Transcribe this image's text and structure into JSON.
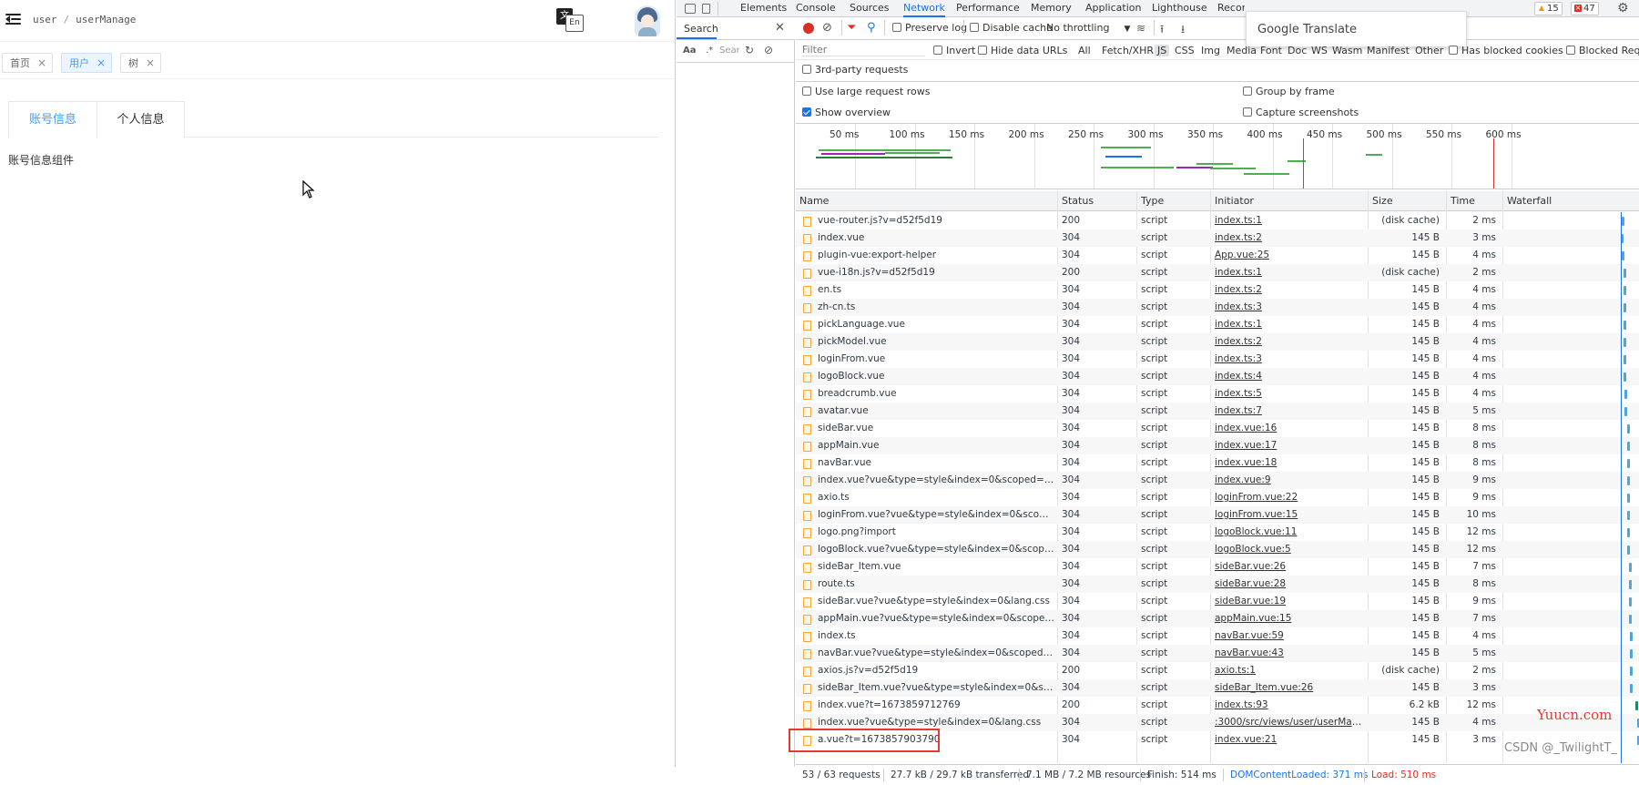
{
  "app": {
    "breadcrumb": [
      "user",
      "userManage"
    ],
    "language_icon": {
      "zh": "文",
      "en": "En"
    },
    "tags": [
      {
        "label": "首页",
        "active": false
      },
      {
        "label": "用户",
        "active": true
      },
      {
        "label": "树",
        "active": false
      }
    ],
    "tabs": [
      {
        "label": "账号信息",
        "active": true
      },
      {
        "label": "个人信息",
        "active": false
      }
    ],
    "panel_text": "账号信息组件"
  },
  "devtools": {
    "tabs": [
      "Elements",
      "Console",
      "Sources",
      "Network",
      "Performance",
      "Memory",
      "Application",
      "Lighthouse",
      "Recor"
    ],
    "active_tab": "Network",
    "translate_popup": "Google Translate",
    "warnings": "15",
    "errors": "47",
    "search": {
      "title": "Search",
      "case_label": "Aa",
      "regex_label": ".*",
      "placeholder": "Sear"
    },
    "toolbar": {
      "preserve_log": "Preserve log",
      "disable_cache": "Disable cache",
      "throttling": "No throttling"
    },
    "filter": {
      "placeholder": "Filter",
      "invert": "Invert",
      "hide_data_urls": "Hide data URLs",
      "types": [
        "All",
        "Fetch/XHR",
        "JS",
        "CSS",
        "Img",
        "Media",
        "Font",
        "Doc",
        "WS",
        "Wasm",
        "Manifest",
        "Other"
      ],
      "active_type": "JS",
      "blocked_cookies": "Has blocked cookies",
      "blocked_requests": "Blocked Reque"
    },
    "third_party": "3rd-party requests",
    "settings": {
      "large_rows": "Use large request rows",
      "show_overview": "Show overview",
      "group_by_frame": "Group by frame",
      "capture_screenshots": "Capture screenshots"
    },
    "overview_ticks": [
      "50 ms",
      "100 ms",
      "150 ms",
      "200 ms",
      "250 ms",
      "300 ms",
      "350 ms",
      "400 ms",
      "450 ms",
      "500 ms",
      "550 ms",
      "600 ms"
    ],
    "columns": [
      "Name",
      "Status",
      "Type",
      "Initiator",
      "Size",
      "Time",
      "Waterfall"
    ],
    "requests": [
      {
        "name": "vue-router.js?v=d52f5d19",
        "status": "200",
        "type": "script",
        "initiator": "index.ts:1",
        "size": "(disk cache)",
        "time": "2 ms",
        "wf": 0.88
      },
      {
        "name": "index.vue",
        "status": "304",
        "type": "script",
        "initiator": "index.ts:2",
        "size": "145 B",
        "time": "3 ms",
        "wf": 0.87
      },
      {
        "name": "plugin-vue:export-helper",
        "status": "304",
        "type": "script",
        "initiator": "App.vue:25",
        "size": "145 B",
        "time": "4 ms",
        "wf": 0.88
      },
      {
        "name": "vue-i18n.js?v=d52f5d19",
        "status": "200",
        "type": "script",
        "initiator": "index.ts:1",
        "size": "(disk cache)",
        "time": "2 ms",
        "wf": 0.89
      },
      {
        "name": "en.ts",
        "status": "304",
        "type": "script",
        "initiator": "index.ts:2",
        "size": "145 B",
        "time": "4 ms",
        "wf": 0.89
      },
      {
        "name": "zh-cn.ts",
        "status": "304",
        "type": "script",
        "initiator": "index.ts:3",
        "size": "145 B",
        "time": "4 ms",
        "wf": 0.89
      },
      {
        "name": "pickLanguage.vue",
        "status": "304",
        "type": "script",
        "initiator": "index.ts:1",
        "size": "145 B",
        "time": "4 ms",
        "wf": 0.89
      },
      {
        "name": "pickModel.vue",
        "status": "304",
        "type": "script",
        "initiator": "index.ts:2",
        "size": "145 B",
        "time": "4 ms",
        "wf": 0.89
      },
      {
        "name": "loginFrom.vue",
        "status": "304",
        "type": "script",
        "initiator": "index.ts:3",
        "size": "145 B",
        "time": "4 ms",
        "wf": 0.89
      },
      {
        "name": "logoBlock.vue",
        "status": "304",
        "type": "script",
        "initiator": "index.ts:4",
        "size": "145 B",
        "time": "4 ms",
        "wf": 0.89
      },
      {
        "name": "breadcrumb.vue",
        "status": "304",
        "type": "script",
        "initiator": "index.ts:5",
        "size": "145 B",
        "time": "4 ms",
        "wf": 0.9
      },
      {
        "name": "avatar.vue",
        "status": "304",
        "type": "script",
        "initiator": "index.ts:7",
        "size": "145 B",
        "time": "5 ms",
        "wf": 0.9
      },
      {
        "name": "sideBar.vue",
        "status": "304",
        "type": "script",
        "initiator": "index.vue:16",
        "size": "145 B",
        "time": "8 ms",
        "wf": 0.92
      },
      {
        "name": "appMain.vue",
        "status": "304",
        "type": "script",
        "initiator": "index.vue:17",
        "size": "145 B",
        "time": "8 ms",
        "wf": 0.92
      },
      {
        "name": "navBar.vue",
        "status": "304",
        "type": "script",
        "initiator": "index.vue:18",
        "size": "145 B",
        "time": "8 ms",
        "wf": 0.92
      },
      {
        "name": "index.vue?vue&type=style&index=0&scoped=true...",
        "status": "304",
        "type": "script",
        "initiator": "index.vue:9",
        "size": "145 B",
        "time": "9 ms",
        "wf": 0.92
      },
      {
        "name": "axio.ts",
        "status": "304",
        "type": "script",
        "initiator": "loginFrom.vue:22",
        "size": "145 B",
        "time": "9 ms",
        "wf": 0.92
      },
      {
        "name": "loginFrom.vue?vue&type=style&index=0&scoped=t...",
        "status": "304",
        "type": "script",
        "initiator": "loginFrom.vue:15",
        "size": "145 B",
        "time": "10 ms",
        "wf": 0.92
      },
      {
        "name": "logo.png?import",
        "status": "304",
        "type": "script",
        "initiator": "logoBlock.vue:11",
        "size": "145 B",
        "time": "12 ms",
        "wf": 0.92
      },
      {
        "name": "logoBlock.vue?vue&type=style&index=0&scoped=t...",
        "status": "304",
        "type": "script",
        "initiator": "logoBlock.vue:5",
        "size": "145 B",
        "time": "12 ms",
        "wf": 0.92
      },
      {
        "name": "sideBar_Item.vue",
        "status": "304",
        "type": "script",
        "initiator": "sideBar.vue:26",
        "size": "145 B",
        "time": "7 ms",
        "wf": 0.93
      },
      {
        "name": "route.ts",
        "status": "304",
        "type": "script",
        "initiator": "sideBar.vue:28",
        "size": "145 B",
        "time": "8 ms",
        "wf": 0.93
      },
      {
        "name": "sideBar.vue?vue&type=style&index=0&lang.css",
        "status": "304",
        "type": "script",
        "initiator": "sideBar.vue:19",
        "size": "145 B",
        "time": "9 ms",
        "wf": 0.93
      },
      {
        "name": "appMain.vue?vue&type=style&index=0&scoped=tr...",
        "status": "304",
        "type": "script",
        "initiator": "appMain.vue:15",
        "size": "145 B",
        "time": "7 ms",
        "wf": 0.93
      },
      {
        "name": "index.ts",
        "status": "304",
        "type": "script",
        "initiator": "navBar.vue:59",
        "size": "145 B",
        "time": "4 ms",
        "wf": 0.94
      },
      {
        "name": "navBar.vue?vue&type=style&index=0&scoped=true...",
        "status": "304",
        "type": "script",
        "initiator": "navBar.vue:43",
        "size": "145 B",
        "time": "5 ms",
        "wf": 0.94
      },
      {
        "name": "axios.js?v=d52f5d19",
        "status": "200",
        "type": "script",
        "initiator": "axio.ts:1",
        "size": "(disk cache)",
        "time": "2 ms",
        "wf": 0.94
      },
      {
        "name": "sideBar_Item.vue?vue&type=style&index=0&scope...",
        "status": "304",
        "type": "script",
        "initiator": "sideBar_Item.vue:26",
        "size": "145 B",
        "time": "3 ms",
        "wf": 0.94
      },
      {
        "name": "index.vue?t=1673859712769",
        "status": "200",
        "type": "script",
        "initiator": "index.ts:93",
        "size": "6.2 kB",
        "time": "12 ms",
        "wf": 0.98
      },
      {
        "name": "index.vue?vue&type=style&index=0&lang.css",
        "status": "304",
        "type": "script",
        "initiator": ":3000/src/views/user/userMana...",
        "size": "145 B",
        "time": "4 ms",
        "wf": 0.99
      },
      {
        "name": "a.vue?t=1673857903790",
        "status": "304",
        "type": "script",
        "initiator": "index.vue:21",
        "size": "145 B",
        "time": "3 ms",
        "wf": 0.99
      }
    ],
    "status_bar": {
      "requests": "53 / 63 requests",
      "transferred": "27.7 kB / 29.7 kB transferred",
      "resources": "7.1 MB / 7.2 MB resources",
      "finish": "Finish: 514 ms",
      "dom_content_loaded": "DOMContentLoaded: 371 ms",
      "load": "Load: 510 ms"
    }
  },
  "watermarks": {
    "site": "Yuucn.com",
    "author": "CSDN @_TwilightT_"
  },
  "colors": {
    "accent": "#1a73e8",
    "element_primary": "#409eff",
    "load_red": "#d93025",
    "dcl_blue": "#1a73e8",
    "highlight_red": "#e53935"
  }
}
